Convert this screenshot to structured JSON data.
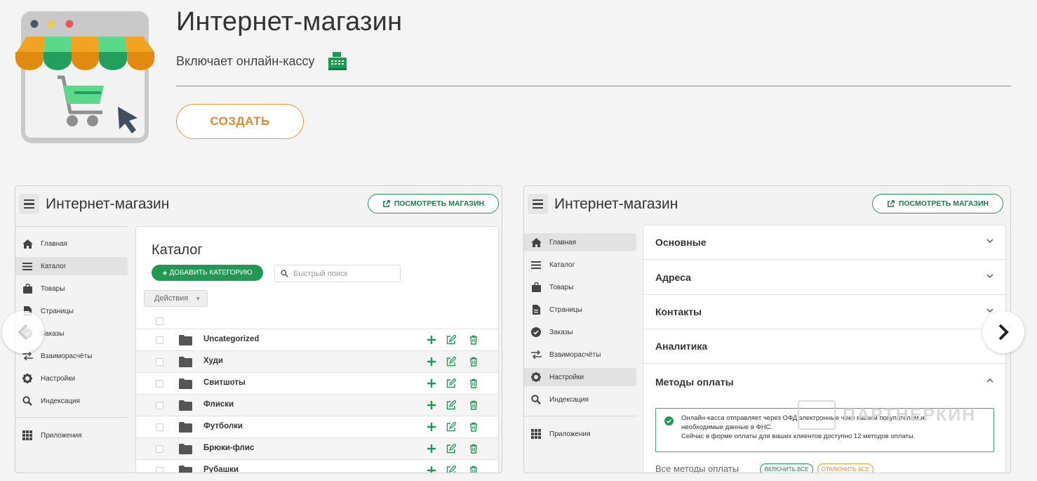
{
  "hero": {
    "title": "Интернет-магазин",
    "subtitle": "Включает онлайн-кассу",
    "create_label": "СОЗДАТЬ",
    "icons": [
      "storefront-cart-icon",
      "cash-register-icon"
    ]
  },
  "left_shot": {
    "app_title": "Интернет-магазин",
    "view_store_label": "ПОСМОТРЕТЬ МАГАЗИН",
    "sidebar": [
      {
        "label": "Главная",
        "icon": "home-icon"
      },
      {
        "label": "Каталог",
        "icon": "list-icon",
        "active": true
      },
      {
        "label": "Товары",
        "icon": "bag-icon"
      },
      {
        "label": "Страницы",
        "icon": "page-icon"
      },
      {
        "label": "Заказы",
        "icon": "check-circle-icon"
      },
      {
        "label": "Взаиморасчёты",
        "icon": "swap-icon"
      },
      {
        "label": "Настройки",
        "icon": "gear-icon"
      },
      {
        "label": "Индексация",
        "icon": "search-icon"
      },
      {
        "label": "Приложения",
        "icon": "apps-grid-icon"
      }
    ],
    "catalog": {
      "title": "Каталог",
      "add_category_label": "ДОБАВИТЬ КАТЕГОРИЮ",
      "search_placeholder": "Быстрый поиск",
      "actions_label": "Действия",
      "rows": [
        "Uncategorized",
        "Худи",
        "Свитшоты",
        "Флиски",
        "Футболки",
        "Брюки-флис",
        "Рубашки"
      ]
    }
  },
  "right_shot": {
    "app_title": "Интернет-магазин",
    "view_store_label": "ПОСМОТРЕТЬ МАГАЗИН",
    "sidebar": [
      {
        "label": "Главная",
        "icon": "home-icon",
        "active": true
      },
      {
        "label": "Каталог",
        "icon": "list-icon"
      },
      {
        "label": "Товары",
        "icon": "bag-icon"
      },
      {
        "label": "Страницы",
        "icon": "page-icon"
      },
      {
        "label": "Заказы",
        "icon": "check-circle-icon"
      },
      {
        "label": "Взаиморасчёты",
        "icon": "swap-icon"
      },
      {
        "label": "Настройки",
        "icon": "gear-icon",
        "active": true
      },
      {
        "label": "Индексация",
        "icon": "search-icon"
      },
      {
        "label": "Приложения",
        "icon": "apps-grid-icon"
      }
    ],
    "sections": [
      "Основные",
      "Адреса",
      "Контакты",
      "Аналитика",
      "Методы оплаты"
    ],
    "notice": {
      "line1": "Онлайн-касса отправляет через ОФД электронные чеки вашим покупателям и",
      "line2": "необходимые данные в ФНС.",
      "line3": "Сейчас в форме оплаты для ваших клиентов доступно 12 методов оплаты."
    },
    "all_methods_label": "Все методы оплаты",
    "enable_all_label": "ВКЛЮЧИТЬ ВСЕ",
    "disable_all_label": "ОТКЛЮЧИТЬ ВСЕ"
  },
  "watermark": "ПАРТНЕРКИН",
  "colors": {
    "accent_green": "#1f9a55",
    "accent_orange": "#e89a3c"
  }
}
